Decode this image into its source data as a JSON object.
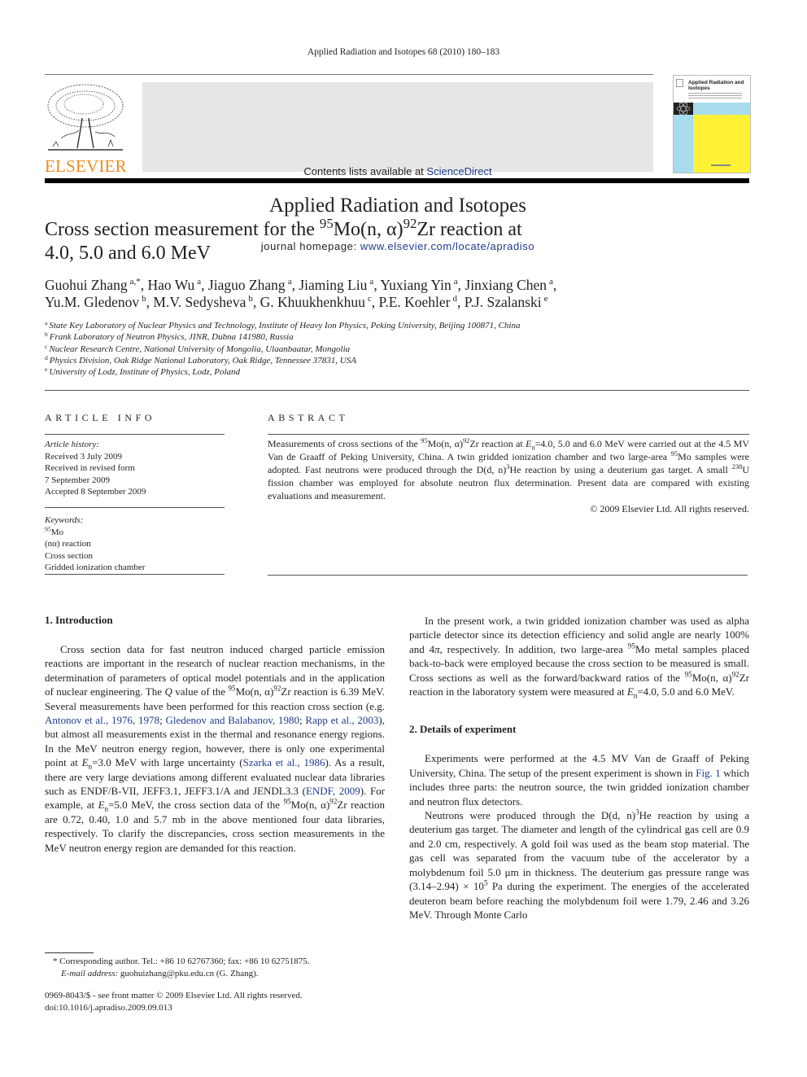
{
  "header": {
    "running_head": "Applied Radiation and Isotopes 68 (2010) 180–183",
    "publisher_logo_text": "ELSEVIER",
    "contents_prefix": "Contents lists available at ",
    "contents_link": "ScienceDirect",
    "journal_title": "Applied Radiation and Isotopes",
    "homepage_prefix": "journal homepage: ",
    "homepage_link": "www.elsevier.com/locate/apradiso",
    "cover_title": "Applied Radiation and Isotopes",
    "colors": {
      "logo_orange": "#f08b1d",
      "link_blue": "#1f3b8c",
      "cover_blue": "#a8dced",
      "cover_yellow": "#fff236",
      "banner_gray": "#e6e6e6"
    }
  },
  "article": {
    "title": [
      {
        "t": "Cross section measurement for the "
      },
      {
        "t": "95",
        "s": "sup"
      },
      {
        "t": "Mo(n, α)"
      },
      {
        "t": "92",
        "s": "sup"
      },
      {
        "t": "Zr reaction at"
      },
      {
        "br": true
      },
      {
        "t": "4.0, 5.0 and 6.0 MeV"
      }
    ],
    "authors": [
      {
        "name": "Guohui Zhang",
        "aff": "a,*"
      },
      {
        "name": "Hao Wu",
        "aff": "a"
      },
      {
        "name": "Jiaguo Zhang",
        "aff": "a"
      },
      {
        "name": "Jiaming Liu",
        "aff": "a"
      },
      {
        "name": "Yuxiang Yin",
        "aff": "a"
      },
      {
        "name": "Jinxiang Chen",
        "aff": "a",
        "break_after": true
      },
      {
        "name": "Yu.M. Gledenov",
        "aff": "b"
      },
      {
        "name": "M.V. Sedysheva",
        "aff": "b"
      },
      {
        "name": "G. Khuukhenkhuu",
        "aff": "c"
      },
      {
        "name": "P.E. Koehler",
        "aff": "d"
      },
      {
        "name": "P.J. Szalanski",
        "aff": "e"
      }
    ],
    "affiliations": [
      {
        "key": "a",
        "text": "State Key Laboratory of Nuclear Physics and Technology, Institute of Heavy Ion Physics, Peking University, Beijing 100871, China"
      },
      {
        "key": "b",
        "text": "Frank Laboratory of Neutron Physics, JINR, Dubna 141980, Russia"
      },
      {
        "key": "c",
        "text": "Nuclear Research Centre, National University of Mongolia, Ulaanbaatar, Mongolia"
      },
      {
        "key": "d",
        "text": "Physics Division, Oak Ridge National Laboratory, Oak Ridge, Tennessee 37831, USA"
      },
      {
        "key": "e",
        "text": "University of Lodz, Institute of Physics, Lodz, Poland"
      }
    ]
  },
  "article_info": {
    "heading": "ARTICLE INFO",
    "history_label": "Article history:",
    "history": [
      "Received 3 July 2009",
      "Received in revised form",
      "7 September 2009",
      "Accepted 8 September 2009"
    ],
    "keywords_label": "Keywords:",
    "keywords": [
      [
        {
          "t": "95",
          "s": "sup"
        },
        {
          "t": "Mo"
        }
      ],
      [
        {
          "t": "(nα) reaction"
        }
      ],
      [
        {
          "t": "Cross section"
        }
      ],
      [
        {
          "t": "Gridded ionization chamber"
        }
      ]
    ]
  },
  "abstract": {
    "heading": "ABSTRACT",
    "body": [
      {
        "t": "Measurements of cross sections of the "
      },
      {
        "t": "95",
        "s": "sup"
      },
      {
        "t": "Mo(n, α)"
      },
      {
        "t": "92",
        "s": "sup"
      },
      {
        "t": "Zr reaction at "
      },
      {
        "t": "E",
        "s": "it"
      },
      {
        "t": "n",
        "s": "sub"
      },
      {
        "t": "=4.0, 5.0 and 6.0 MeV were carried out at the 4.5 MV Van de Graaff of Peking University, China. A twin gridded ionization chamber and two large-area "
      },
      {
        "t": "95",
        "s": "sup"
      },
      {
        "t": "Mo samples were adopted. Fast neutrons were produced through the D(d, n)"
      },
      {
        "t": "3",
        "s": "sup"
      },
      {
        "t": "He reaction by using a deuterium gas target. A small "
      },
      {
        "t": "238",
        "s": "sup"
      },
      {
        "t": "U fission chamber was employed for absolute neutron flux determination. Present data are compared with existing evaluations and measurement."
      }
    ],
    "copyright": "© 2009 Elsevier Ltd. All rights reserved."
  },
  "sections": {
    "intro_heading": "1.  Introduction",
    "intro_paragraphs": [
      [
        {
          "t": "Cross section data for fast neutron induced charged particle emission reactions are important in the research of nuclear reaction mechanisms, in the determination of parameters of optical model potentials and in the application of nuclear engineering. The "
        },
        {
          "t": "Q",
          "s": "it"
        },
        {
          "t": " value of the "
        },
        {
          "t": "95",
          "s": "sup"
        },
        {
          "t": "Mo(n, α)"
        },
        {
          "t": "92",
          "s": "sup"
        },
        {
          "t": "Zr reaction is 6.39 MeV. Several measurements have been performed for this reaction cross section (e.g. "
        },
        {
          "t": "Antonov et al., 1976, 1978",
          "s": "link"
        },
        {
          "t": "; "
        },
        {
          "t": "Gledenov and Balabanov, 1980",
          "s": "link"
        },
        {
          "t": "; "
        },
        {
          "t": "Rapp et al., 2003",
          "s": "link"
        },
        {
          "t": "), but almost all measurements exist in the thermal and resonance energy regions. In the MeV neutron energy region, however, there is only one experimental point at "
        },
        {
          "t": "E",
          "s": "it"
        },
        {
          "t": "n",
          "s": "sub"
        },
        {
          "t": "=3.0 MeV with large uncertainty ("
        },
        {
          "t": "Szarka et al., 1986",
          "s": "link"
        },
        {
          "t": "). As a result, there are very large deviations among different evaluated nuclear data libraries such as ENDF/B-VII, JEFF3.1, JEFF3.1/A and JENDL3.3 ("
        },
        {
          "t": "ENDF, 2009",
          "s": "link"
        },
        {
          "t": "). For example, at "
        },
        {
          "t": "E",
          "s": "it"
        },
        {
          "t": "n",
          "s": "sub"
        },
        {
          "t": "=5.0 MeV, the cross section data of the "
        },
        {
          "t": "95",
          "s": "sup"
        },
        {
          "t": "Mo(n, α)"
        },
        {
          "t": "92",
          "s": "sup"
        },
        {
          "t": "Zr reaction are 0.72, 0.40, 1.0 and 5.7 mb in the above mentioned four data libraries, respectively. To clarify the discrepancies, cross section measurements in the MeV neutron energy region are demanded for this reaction."
        }
      ]
    ],
    "right_paragraph_1": [
      {
        "t": "In the present work, a twin gridded ionization chamber was used as alpha particle detector since its detection efficiency and solid angle are nearly 100% and 4"
      },
      {
        "t": "π",
        "s": "it"
      },
      {
        "t": ", respectively. In addition, two large-area "
      },
      {
        "t": "95",
        "s": "sup"
      },
      {
        "t": "Mo metal samples placed back-to-back were employed because the cross section to be measured is small. Cross sections as well as the forward/backward ratios of the "
      },
      {
        "t": "95",
        "s": "sup"
      },
      {
        "t": "Mo(n, α)"
      },
      {
        "t": "92",
        "s": "sup"
      },
      {
        "t": "Zr reaction in the laboratory system were measured at "
      },
      {
        "t": "E",
        "s": "it"
      },
      {
        "t": "n",
        "s": "sub"
      },
      {
        "t": "=4.0, 5.0 and 6.0 MeV."
      }
    ],
    "details_heading": "2.  Details of experiment",
    "details_paragraphs": [
      [
        {
          "t": "Experiments were performed at the 4.5 MV Van de Graaff of Peking University, China. The setup of the present experiment is shown in "
        },
        {
          "t": "Fig. 1",
          "s": "link"
        },
        {
          "t": " which includes three parts: the neutron source, the twin gridded ionization chamber and neutron flux detectors."
        }
      ],
      [
        {
          "t": "Neutrons were produced through the D(d, n)"
        },
        {
          "t": "3",
          "s": "sup"
        },
        {
          "t": "He reaction by using a deuterium gas target. The diameter and length of the cylindrical gas cell are 0.9 and 2.0 cm, respectively. A gold foil was used as the beam stop material. The gas cell was separated from the vacuum tube of the accelerator by a molybdenum foil 5.0 μm in thickness. The deuterium gas pressure range was (3.14–2.94) × 10"
        },
        {
          "t": "5",
          "s": "sup"
        },
        {
          "t": " Pa during the experiment. The energies of the accelerated deuteron beam before reaching the molybdenum foil were 1.79, 2.46 and 3.26 MeV. Through Monte Carlo"
        }
      ]
    ]
  },
  "footnote": {
    "corresponding": "* Corresponding author. Tel.: +86 10 62767360; fax: +86 10 62751875.",
    "email_label": "E-mail address:",
    "email": " guohuizhang@pku.edu.cn (G. Zhang).",
    "front_matter": "0969-8043/$ - see front matter © 2009 Elsevier Ltd. All rights reserved.",
    "doi": "doi:10.1016/j.apradiso.2009.09.013"
  }
}
